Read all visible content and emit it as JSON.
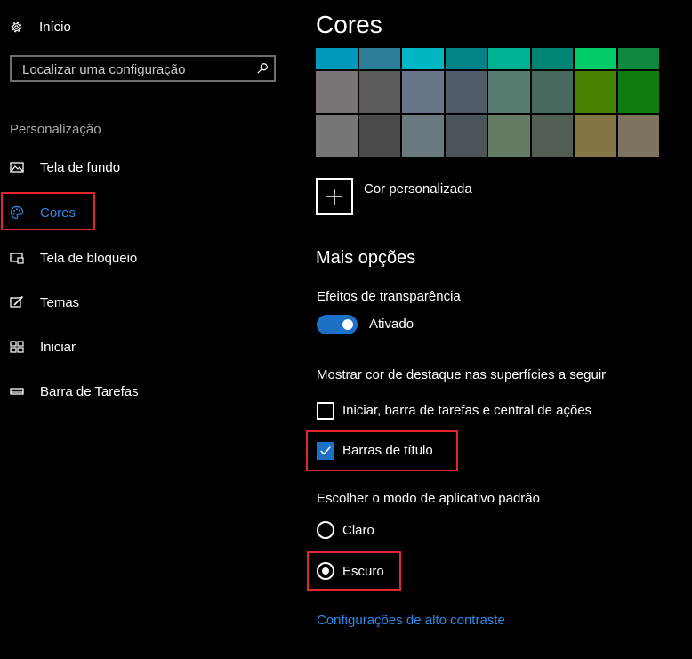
{
  "sidebar": {
    "home_label": "Início",
    "search_placeholder": "Localizar uma configuração",
    "section_label": "Personalização",
    "items": [
      {
        "label": "Tela de fundo",
        "icon": "picture-icon"
      },
      {
        "label": "Cores",
        "icon": "palette-icon",
        "active": true
      },
      {
        "label": "Tela de bloqueio",
        "icon": "lock-screen-icon"
      },
      {
        "label": "Temas",
        "icon": "themes-icon"
      },
      {
        "label": "Iniciar",
        "icon": "start-icon"
      },
      {
        "label": "Barra de Tarefas",
        "icon": "taskbar-icon"
      }
    ]
  },
  "main": {
    "title": "Cores",
    "swatches": [
      [
        "#0099bc",
        "#2d7d9a",
        "#00b7c3",
        "#038387",
        "#00b294",
        "#018574",
        "#00cc6a",
        "#10893e"
      ],
      [
        "#7a7574",
        "#5d5a58",
        "#68768a",
        "#515c6b",
        "#567c73",
        "#486860",
        "#498205",
        "#107c10"
      ],
      [
        "#767676",
        "#4c4a48",
        "#69797e",
        "#4a5459",
        "#647c64",
        "#525e54",
        "#847545",
        "#7e735f"
      ]
    ],
    "custom_color_label": "Cor personalizada",
    "more_options_heading": "Mais opções",
    "transparency": {
      "label": "Efeitos de transparência",
      "state": "Ativado",
      "on": true
    },
    "accent_surfaces": {
      "label": "Mostrar cor de destaque nas superfícies a seguir",
      "options": [
        {
          "label": "Iniciar, barra de tarefas e central de ações",
          "checked": false
        },
        {
          "label": "Barras de título",
          "checked": true
        }
      ]
    },
    "app_mode": {
      "label": "Escolher o modo de aplicativo padrão",
      "options": [
        {
          "label": "Claro",
          "selected": false
        },
        {
          "label": "Escuro",
          "selected": true
        }
      ]
    },
    "high_contrast_link": "Configurações de alto contraste"
  },
  "colors": {
    "accent": "#1c71c7",
    "link": "#2d8ae6",
    "highlight": "#e0272d",
    "background": "#000000"
  }
}
